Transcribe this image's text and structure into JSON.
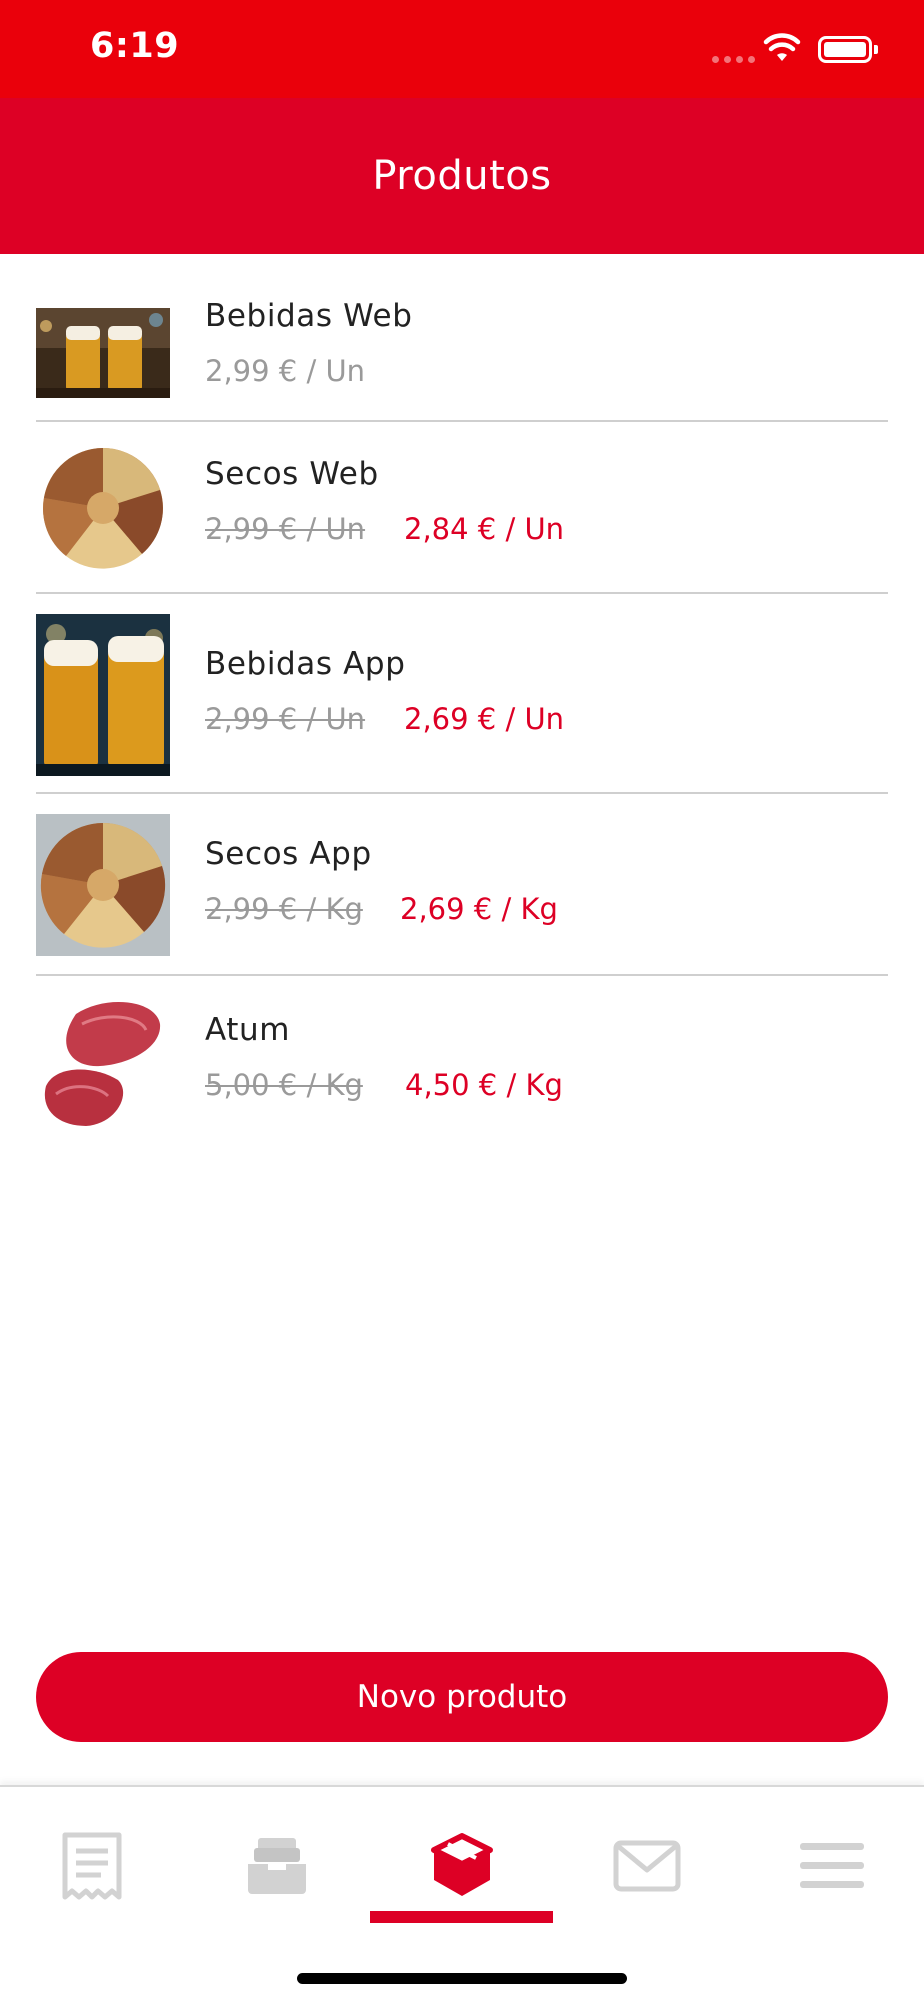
{
  "status_bar": {
    "time": "6:19"
  },
  "header": {
    "title": "Produtos"
  },
  "products": [
    {
      "name": "Bebidas Web",
      "price": "2,99 € / Un",
      "sale_price": "",
      "image": "beer-mugs-image"
    },
    {
      "name": "Secos Web",
      "price": "2,99 € / Un",
      "sale_price": "2,84 € / Un",
      "image": "dried-nuts-image"
    },
    {
      "name": "Bebidas App",
      "price": "2,99 € / Un",
      "sale_price": "2,69 € / Un",
      "image": "beer-glasses-image"
    },
    {
      "name": "Secos App",
      "price": "2,99 € / Kg",
      "sale_price": "2,69 € / Kg",
      "image": "dried-nuts-image"
    },
    {
      "name": "Atum",
      "price": "5,00 € / Kg",
      "sale_price": "4,50 € / Kg",
      "image": "tuna-steak-image"
    }
  ],
  "new_product_button": "Novo produto",
  "tab_bar": {
    "tabs": [
      {
        "icon": "receipt-icon",
        "active": false
      },
      {
        "icon": "inbox-tray-icon",
        "active": false
      },
      {
        "icon": "box-icon",
        "active": true
      },
      {
        "icon": "envelope-icon",
        "active": false
      },
      {
        "icon": "menu-icon",
        "active": false
      }
    ]
  },
  "colors": {
    "status_bar": "#ea000b",
    "header": "#dd0025",
    "accent": "#dd0025",
    "muted_text": "#9a9a9a",
    "icon_inactive": "#d2d2d2"
  }
}
